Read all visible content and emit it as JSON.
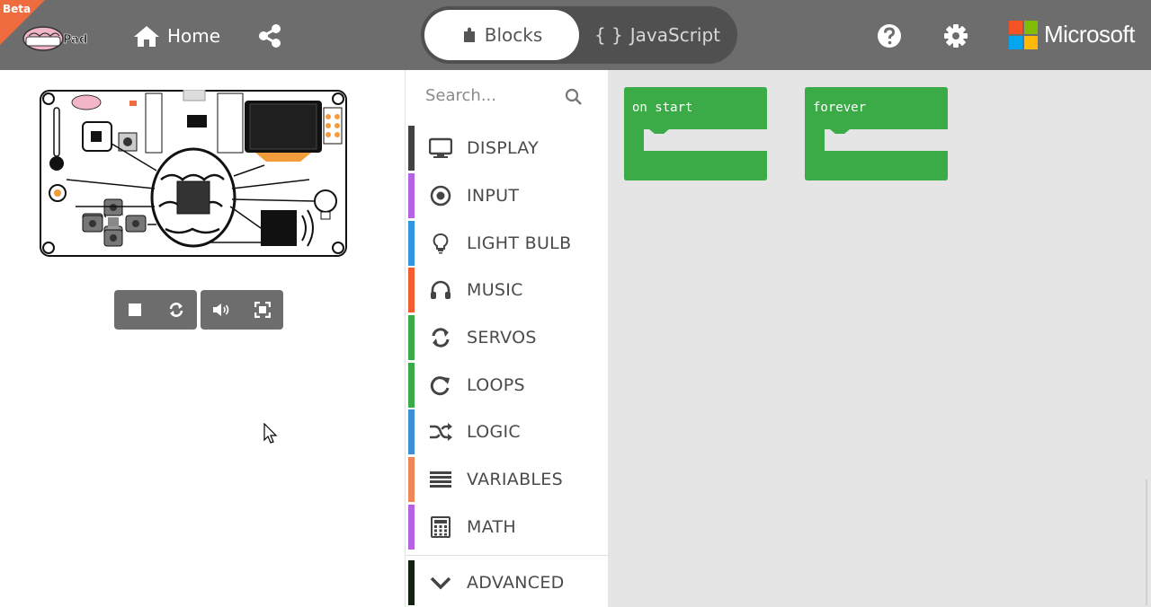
{
  "header": {
    "beta_label": "Beta",
    "logo_text": "BrainPad",
    "home_label": "Home",
    "tabs": [
      {
        "label": "Blocks",
        "icon": "puzzle-icon",
        "active": true
      },
      {
        "label": "JavaScript",
        "icon": "braces-icon",
        "active": false
      }
    ],
    "js_prefix": "{ }",
    "brand": "Microsoft",
    "colors": {
      "header_bg": "#6d6d6d",
      "beta": "#ef6c3e"
    }
  },
  "simulator": {
    "buttons": [
      "stop-icon",
      "restart-icon",
      "mute-icon",
      "fullscreen-icon"
    ]
  },
  "toolbox": {
    "search_placeholder": "Search...",
    "categories": [
      {
        "label": "DISPLAY",
        "color": "#424242",
        "icon": "monitor-icon"
      },
      {
        "label": "INPUT",
        "color": "#b563e3",
        "icon": "radio-button-icon"
      },
      {
        "label": "LIGHT BULB",
        "color": "#2f97e0",
        "icon": "lightbulb-icon"
      },
      {
        "label": "MUSIC",
        "color": "#f45d2f",
        "icon": "headphones-icon"
      },
      {
        "label": "SERVOS",
        "color": "#3aab47",
        "icon": "refresh-icon"
      },
      {
        "label": "LOOPS",
        "color": "#3aab47",
        "icon": "loop-icon"
      },
      {
        "label": "LOGIC",
        "color": "#3d8fd6",
        "icon": "shuffle-icon"
      },
      {
        "label": "VARIABLES",
        "color": "#f0855a",
        "icon": "list-icon"
      },
      {
        "label": "MATH",
        "color": "#b563e3",
        "icon": "calculator-icon"
      }
    ],
    "advanced": {
      "label": "ADVANCED",
      "color": "#112211",
      "icon": "chevron-down-icon"
    }
  },
  "workspace": {
    "blocks": [
      {
        "label": "on start",
        "color": "#3aab47"
      },
      {
        "label": "forever",
        "color": "#3aab47"
      }
    ]
  }
}
